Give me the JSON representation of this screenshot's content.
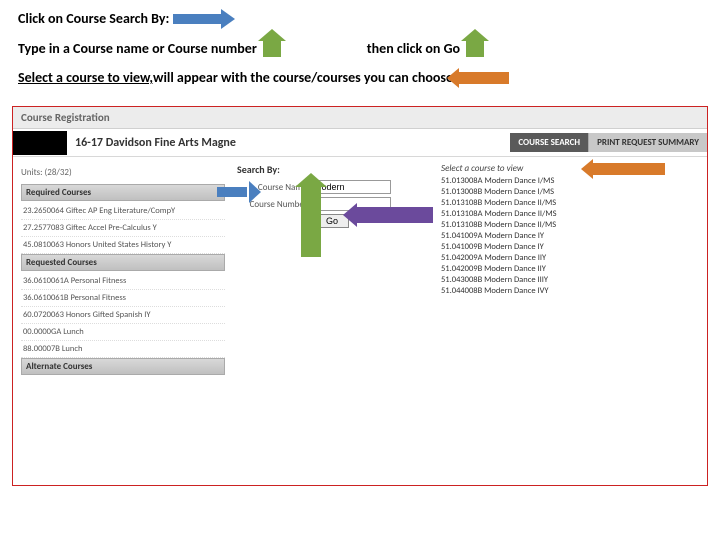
{
  "instructions": {
    "line1": "Click on Course Search By:",
    "line2a": "Type in a Course name or Course number",
    "line2b": "then click on Go",
    "line3a": "Select a course to view,",
    "line3b": " will appear with the course/courses you can choose"
  },
  "app": {
    "titlebar": "Course Registration",
    "school": "16-17 Davidson Fine Arts Magne",
    "tab_search": "COURSE SEARCH",
    "tab_print": "PRINT REQUEST SUMMARY"
  },
  "left": {
    "units": "Units: (28/32)",
    "sec1": "Required Courses",
    "sec1_rows": [
      "23.2650064 Giftec AP Eng Literature/CompY",
      "27.2577083 Giftec Accel Pre-Calculus Y",
      "45.0810063 Honors United States History Y"
    ],
    "sec2": "Requested Courses",
    "sec2_rows": [
      "36.0610061A Personal Fitness",
      "36.0610061B Personal Fitness",
      "60.0720063 Honors Gifted Spanish IY",
      "00.0000GA Lunch",
      "88.00007B Lunch"
    ],
    "sec3": "Alternate Courses"
  },
  "search": {
    "title": "Search By:",
    "name_label": "Course Name",
    "name_value": "Modern",
    "number_label": "Course Number",
    "number_value": "",
    "go": "Go"
  },
  "results": {
    "title": "Select a course to view",
    "rows": [
      "51.013008A Modern Dance I/MS",
      "51.013008B Modern Dance I/MS",
      "51.013108B Modern Dance II/MS",
      "51.013108A Modern Dance II/MS",
      "51.013108B Modern Dance II/MS",
      "51.041009A Modern Dance IY",
      "51.041009B Modern Dance IY",
      "51.042009A Modern Dance IIY",
      "51.042009B Modern Dance IIY",
      "51.043008B Modern Dance IIIY",
      "51.044008B Modern Dance IVY"
    ]
  }
}
